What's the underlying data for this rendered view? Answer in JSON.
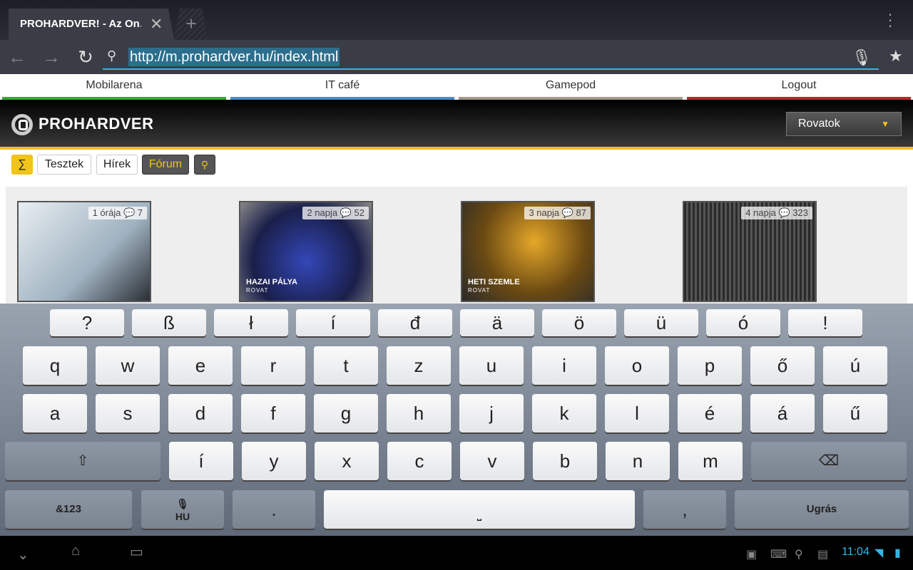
{
  "browser": {
    "tab_title": "PROHARDVER! - Az On…",
    "url": "http://m.prohardver.hu/index.html"
  },
  "site_nav": [
    {
      "label": "Mobilarena",
      "color": "#3aa635"
    },
    {
      "label": "IT café",
      "color": "#4a8bc2"
    },
    {
      "label": "Gamepod",
      "color": "#a09a8a"
    },
    {
      "label": "Logout",
      "color": "#b52a2a"
    }
  ],
  "header": {
    "logo": "PROHARDVER",
    "menu_label": "Rovatok"
  },
  "toolbar": {
    "sigma": "∑",
    "tests": "Tesztek",
    "news": "Hírek",
    "forum": "Fórum"
  },
  "articles": [
    {
      "age": "1 órája",
      "comments": "7",
      "caption": "",
      "caption_sub": "",
      "bg": "#c8d4dc"
    },
    {
      "age": "2 napja",
      "comments": "52",
      "caption": "HAZAI PÁLYA",
      "caption_sub": "ROVAT",
      "bg": "#2d3a8c"
    },
    {
      "age": "3 napja",
      "comments": "87",
      "caption": "HETI SZEMLE",
      "caption_sub": "ROVAT",
      "bg": "#6b5a2a"
    },
    {
      "age": "4 napja",
      "comments": "323",
      "caption": "",
      "caption_sub": "",
      "bg": "#3c3c3c"
    }
  ],
  "keyboard": {
    "symbols": [
      "?",
      "ß",
      "ł",
      "í",
      "đ",
      "ä",
      "ö",
      "ü",
      "ó",
      "!"
    ],
    "row1": [
      "q",
      "w",
      "e",
      "r",
      "t",
      "z",
      "u",
      "i",
      "o",
      "p",
      "ő",
      "ú"
    ],
    "row2": [
      "a",
      "s",
      "d",
      "f",
      "g",
      "h",
      "j",
      "k",
      "l",
      "é",
      "á",
      "ű"
    ],
    "row3": [
      "í",
      "y",
      "x",
      "c",
      "v",
      "b",
      "n",
      "m"
    ],
    "numbers": "&123",
    "lang": "HU",
    "period": ".",
    "comma": ",",
    "go": "Ugrás"
  },
  "status": {
    "time": "11:04"
  }
}
